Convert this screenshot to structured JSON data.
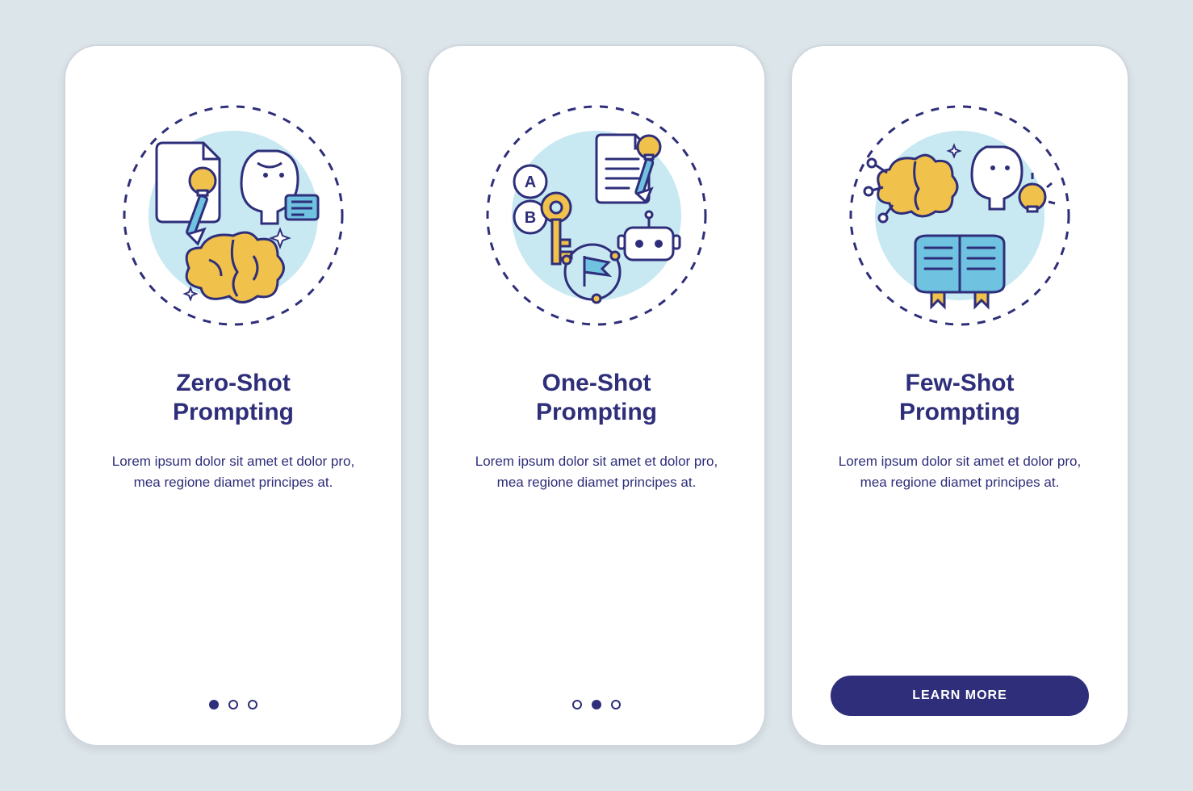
{
  "colors": {
    "navy": "#2e2e7a",
    "lightblue": "#c8e8f2",
    "yellow": "#f0c14b",
    "skyblue": "#6fc2e0",
    "bg": "#dce5ea"
  },
  "lorem": "Lorem ipsum dolor sit amet et dolor pro, mea regione diamet principes at.",
  "screens": [
    {
      "title_line1": "Zero-Shot",
      "title_line2": "Prompting",
      "icon": "zero-shot-icon",
      "activeDot": 0,
      "showButton": false
    },
    {
      "title_line1": "One-Shot",
      "title_line2": "Prompting",
      "icon": "one-shot-icon",
      "activeDot": 1,
      "showButton": false
    },
    {
      "title_line1": "Few-Shot",
      "title_line2": "Prompting",
      "icon": "few-shot-icon",
      "activeDot": null,
      "showButton": true
    }
  ],
  "button_label": "LEARN MORE"
}
